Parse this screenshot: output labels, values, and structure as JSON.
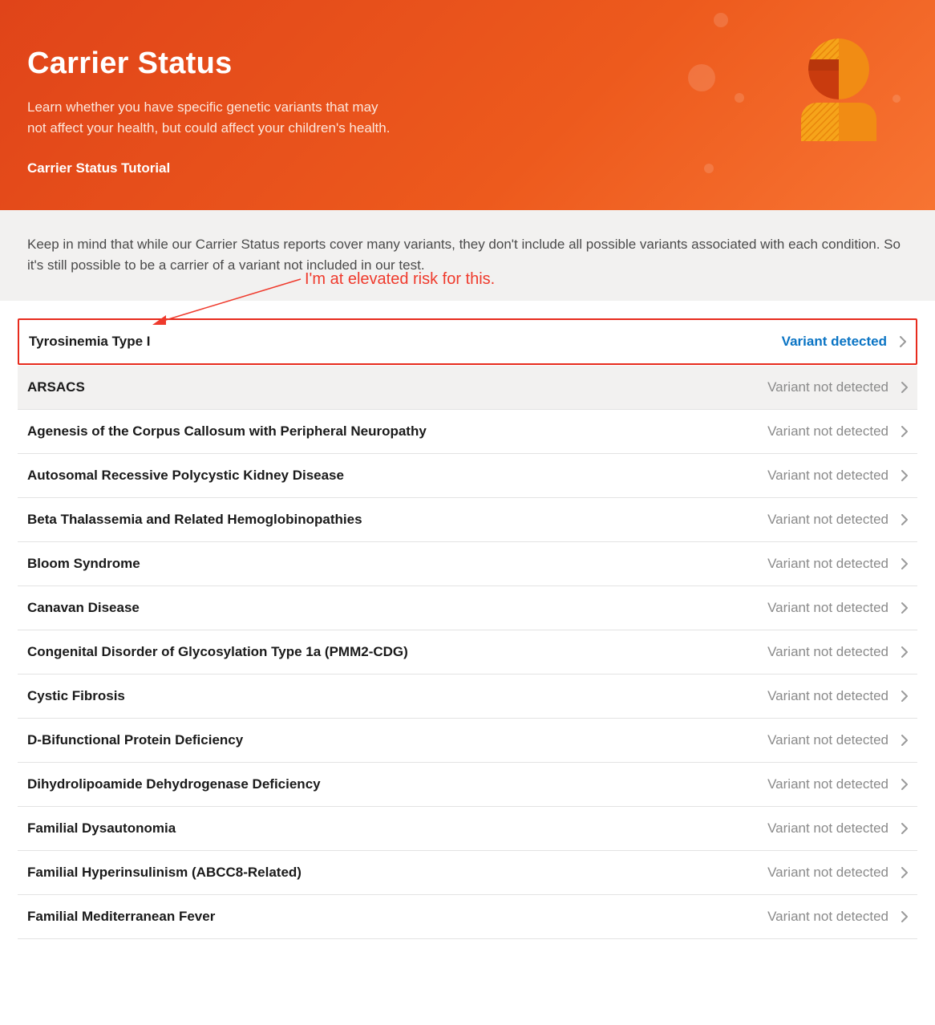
{
  "hero": {
    "title": "Carrier Status",
    "subtitle": "Learn whether you have specific genetic variants that may not affect your health, but could affect your children's health.",
    "tutorial_link": "Carrier Status Tutorial"
  },
  "note": "Keep in mind that while our Carrier Status reports cover many variants, they don't include all possible variants associated with each condition. So it's still possible to be a carrier of a variant not included in our test.",
  "annotation": "I'm at elevated risk for this.",
  "status_labels": {
    "detected": "Variant detected",
    "not_detected": "Variant not detected"
  },
  "rows": [
    {
      "name": "Tyrosinemia Type I",
      "status": "detected",
      "highlighted": true,
      "alt": false
    },
    {
      "name": "ARSACS",
      "status": "not_detected",
      "highlighted": false,
      "alt": true
    },
    {
      "name": "Agenesis of the Corpus Callosum with Peripheral Neuropathy",
      "status": "not_detected",
      "highlighted": false,
      "alt": false
    },
    {
      "name": "Autosomal Recessive Polycystic Kidney Disease",
      "status": "not_detected",
      "highlighted": false,
      "alt": false
    },
    {
      "name": "Beta Thalassemia and Related Hemoglobinopathies",
      "status": "not_detected",
      "highlighted": false,
      "alt": false
    },
    {
      "name": "Bloom Syndrome",
      "status": "not_detected",
      "highlighted": false,
      "alt": false
    },
    {
      "name": "Canavan Disease",
      "status": "not_detected",
      "highlighted": false,
      "alt": false
    },
    {
      "name": "Congenital Disorder of Glycosylation Type 1a (PMM2-CDG)",
      "status": "not_detected",
      "highlighted": false,
      "alt": false
    },
    {
      "name": "Cystic Fibrosis",
      "status": "not_detected",
      "highlighted": false,
      "alt": false
    },
    {
      "name": "D-Bifunctional Protein Deficiency",
      "status": "not_detected",
      "highlighted": false,
      "alt": false
    },
    {
      "name": "Dihydrolipoamide Dehydrogenase Deficiency",
      "status": "not_detected",
      "highlighted": false,
      "alt": false
    },
    {
      "name": "Familial Dysautonomia",
      "status": "not_detected",
      "highlighted": false,
      "alt": false
    },
    {
      "name": "Familial Hyperinsulinism (ABCC8-Related)",
      "status": "not_detected",
      "highlighted": false,
      "alt": false
    },
    {
      "name": "Familial Mediterranean Fever",
      "status": "not_detected",
      "highlighted": false,
      "alt": false
    }
  ],
  "colors": {
    "brand_orange_dark": "#d63a0f",
    "brand_orange_light": "#f77432",
    "link_blue": "#0a74c4",
    "annotation_red": "#ef3a2c",
    "highlight_border": "#e72b1d"
  }
}
